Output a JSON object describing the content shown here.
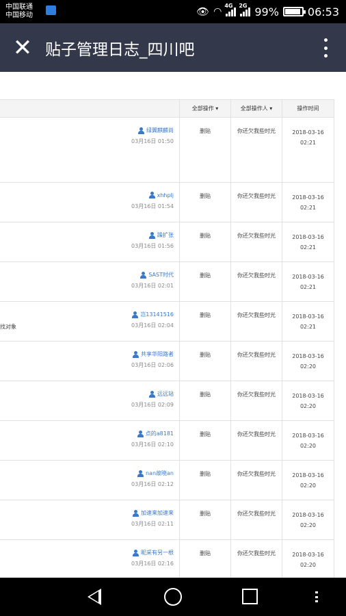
{
  "status_bar": {
    "carrier1": "中国联通",
    "carrier2": "中国移动",
    "net1": "4G",
    "net2": "2G",
    "battery": "99%",
    "time": "06:53",
    "icons": [
      "eye-icon",
      "wifi-icon",
      "signal-icon",
      "battery-icon"
    ]
  },
  "titlebar": {
    "title": "贴子管理日志_四川吧",
    "close_icon": "close-icon",
    "more_icon": "more-vert-icon"
  },
  "table": {
    "headers": {
      "op": "全部操作 ▾",
      "operator": "全部操作人 ▾",
      "time": "操作时间"
    },
    "rows": [
      {
        "user": "绿翼麒麟尚",
        "date": "03月16日 01:50",
        "snippet": "",
        "action": "删贴",
        "operator": "你还欠我些时光",
        "time_date": "2018-03-16",
        "time_clock": "02:21"
      },
      {
        "user": "xhhplj",
        "date": "03月16日 01:54",
        "snippet": "",
        "action": "删贴",
        "operator": "你还欠我些时光",
        "time_date": "2018-03-16",
        "time_clock": "02:21"
      },
      {
        "user": "躁扩张",
        "date": "03月16日 01:56",
        "snippet": "",
        "action": "删贴",
        "operator": "你还欠我些时光",
        "time_date": "2018-03-16",
        "time_clock": "02:21"
      },
      {
        "user": "SAST时代",
        "date": "03月16日 02:01",
        "snippet": "",
        "action": "删贴",
        "operator": "你还欠我些时光",
        "time_date": "2018-03-16",
        "time_clock": "02:21"
      },
      {
        "user": "岂13141516",
        "date": "03月16日 02:04",
        "snippet": "找对象",
        "action": "删贴",
        "operator": "你还欠我些时光",
        "time_date": "2018-03-16",
        "time_clock": "02:21"
      },
      {
        "user": "共享华阳路者",
        "date": "03月16日 02:06",
        "snippet": "",
        "action": "删贴",
        "operator": "你还欠我些时光",
        "time_date": "2018-03-16",
        "time_clock": "02:20"
      },
      {
        "user": "远远站",
        "date": "03月16日 02:09",
        "snippet": "",
        "action": "删贴",
        "operator": "你还欠我些时光",
        "time_date": "2018-03-16",
        "time_clock": "02:20"
      },
      {
        "user": "点的a8181",
        "date": "03月16日 02:10",
        "snippet": "",
        "action": "删贴",
        "operator": "你还欠我些时光",
        "time_date": "2018-03-16",
        "time_clock": "02:20"
      },
      {
        "user": "nan故晓an",
        "date": "03月16日 02:12",
        "snippet": "",
        "action": "删贴",
        "operator": "你还欠我些时光",
        "time_date": "2018-03-16",
        "time_clock": "02:20"
      },
      {
        "user": "加速来加速来",
        "date": "03月16日 02:11",
        "snippet": "",
        "action": "删贴",
        "operator": "你还欠我些时光",
        "time_date": "2018-03-16",
        "time_clock": "02:20"
      },
      {
        "user": "昵采有另一根",
        "date": "03月16日 02:16",
        "snippet": "",
        "action": "删贴",
        "operator": "你还欠我些时光",
        "time_date": "2018-03-16",
        "time_clock": "02:20"
      }
    ]
  },
  "navbar": {
    "icons": [
      "back-icon",
      "home-icon",
      "recents-icon",
      "more-icon"
    ]
  }
}
